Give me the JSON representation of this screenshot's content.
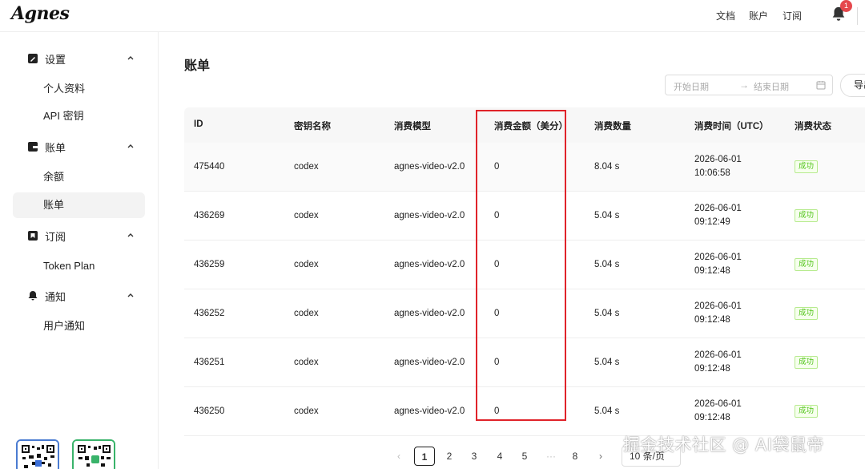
{
  "brand": {
    "logo": "Agnes"
  },
  "topnav": {
    "docs": "文档",
    "account": "账户",
    "subscribe": "订阅",
    "notification_count": "1"
  },
  "sidebar": {
    "groups": [
      {
        "label": "设置",
        "icon": "settings-icon",
        "items": [
          {
            "label": "个人资料"
          },
          {
            "label": "API 密钥"
          }
        ]
      },
      {
        "label": "账单",
        "icon": "wallet-icon",
        "items": [
          {
            "label": "余额"
          },
          {
            "label": "账单",
            "active": true
          }
        ]
      },
      {
        "label": "订阅",
        "icon": "bookmark-icon",
        "items": [
          {
            "label": "Token Plan"
          }
        ]
      },
      {
        "label": "通知",
        "icon": "bell-icon",
        "items": [
          {
            "label": "用户通知"
          }
        ]
      }
    ]
  },
  "main": {
    "title": "账单",
    "date_start_placeholder": "开始日期",
    "date_end_placeholder": "结束日期",
    "export_label": "导出"
  },
  "table": {
    "columns": [
      "ID",
      "密钥名称",
      "消费模型",
      "消费金额（美分）",
      "消费数量",
      "消费时间（UTC）",
      "消费状态"
    ],
    "rows": [
      {
        "id": "475440",
        "key": "codex",
        "model": "agnes-video-v2.0",
        "amount": "0",
        "quantity": "8.04 s",
        "date": "2026-06-01",
        "time": "10:06:58",
        "status": "成功"
      },
      {
        "id": "436269",
        "key": "codex",
        "model": "agnes-video-v2.0",
        "amount": "0",
        "quantity": "5.04 s",
        "date": "2026-06-01",
        "time": "09:12:49",
        "status": "成功"
      },
      {
        "id": "436259",
        "key": "codex",
        "model": "agnes-video-v2.0",
        "amount": "0",
        "quantity": "5.04 s",
        "date": "2026-06-01",
        "time": "09:12:48",
        "status": "成功"
      },
      {
        "id": "436252",
        "key": "codex",
        "model": "agnes-video-v2.0",
        "amount": "0",
        "quantity": "5.04 s",
        "date": "2026-06-01",
        "time": "09:12:48",
        "status": "成功"
      },
      {
        "id": "436251",
        "key": "codex",
        "model": "agnes-video-v2.0",
        "amount": "0",
        "quantity": "5.04 s",
        "date": "2026-06-01",
        "time": "09:12:48",
        "status": "成功"
      },
      {
        "id": "436250",
        "key": "codex",
        "model": "agnes-video-v2.0",
        "amount": "0",
        "quantity": "5.04 s",
        "date": "2026-06-01",
        "time": "09:12:48",
        "status": "成功"
      }
    ]
  },
  "pagination": {
    "pages": [
      "1",
      "2",
      "3",
      "4",
      "5",
      "···",
      "8"
    ],
    "current": "1",
    "page_size": "10 条/页",
    "prev": "‹",
    "next": "›"
  },
  "watermark": "掘金技术社区 @ AI袋鼠帝",
  "colors": {
    "highlight": "#e0232a",
    "success": "#52c41a",
    "badge": "#e5484d"
  }
}
